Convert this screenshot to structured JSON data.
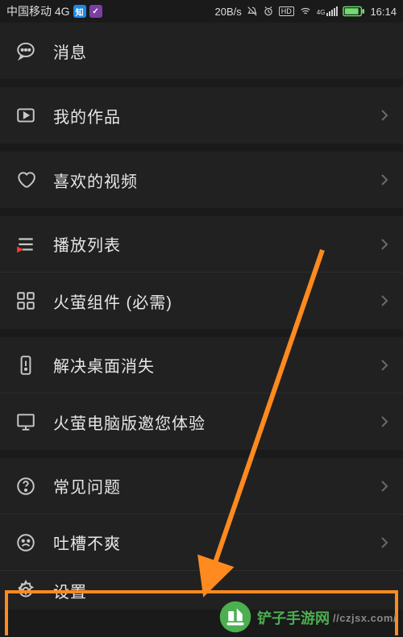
{
  "status_bar": {
    "carrier": "中国移动 4G",
    "badge1": "知",
    "badge2": "✓",
    "net_speed": "20B/s",
    "hd_indicator": "HD",
    "net_gen": "4G",
    "time": "16:14"
  },
  "menu": {
    "messages": "消息",
    "my_works": "我的作品",
    "liked_videos": "喜欢的视频",
    "playlist": "播放列表",
    "widget_required": "火萤组件 (必需)",
    "fix_desktop_missing": "解决桌面消失",
    "pc_version_invite": "火萤电脑版邀您体验",
    "faq": "常见问题",
    "feedback": "吐槽不爽",
    "settings": "设置"
  },
  "annotation": {
    "highlight_color": "#ff8a1f"
  },
  "watermark": {
    "brand": "铲子手游网",
    "url": "//czjsx.com/"
  }
}
